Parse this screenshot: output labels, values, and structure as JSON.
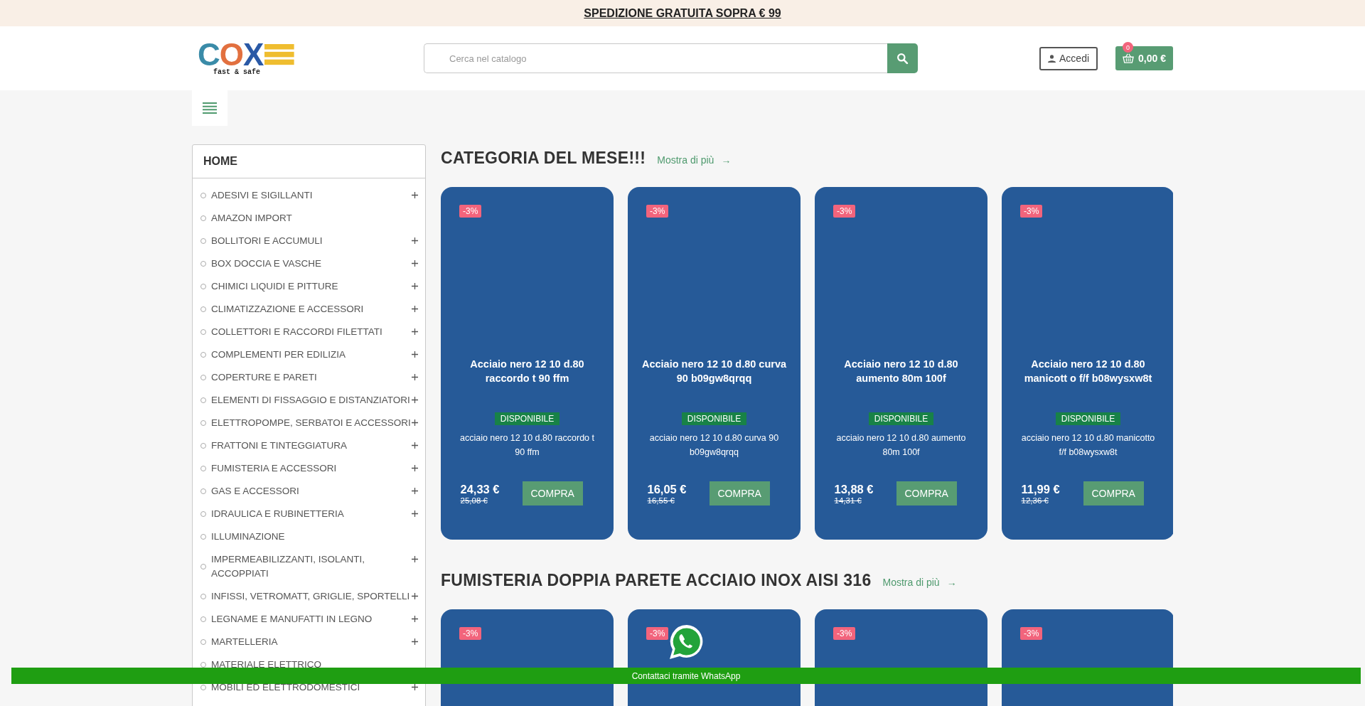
{
  "top_banner": {
    "text": "SPEDIZIONE GRATUITA SOPRA € 99"
  },
  "header": {
    "logo": {
      "text": "COX",
      "tagline": "fast & safe"
    },
    "search": {
      "placeholder": "Cerca nel catalogo"
    },
    "login": {
      "label": "Accedi"
    },
    "cart": {
      "count": "0",
      "total": "0,00 €"
    }
  },
  "sidebar": {
    "title": "HOME",
    "items": [
      {
        "label": "ADESIVI E SIGILLANTI",
        "expandable": true
      },
      {
        "label": "AMAZON IMPORT",
        "expandable": false
      },
      {
        "label": "BOLLITORI E ACCUMULI",
        "expandable": true
      },
      {
        "label": "BOX DOCCIA E VASCHE",
        "expandable": true
      },
      {
        "label": "CHIMICI LIQUIDI E PITTURE",
        "expandable": true
      },
      {
        "label": "CLIMATIZZAZIONE E ACCESSORI",
        "expandable": true
      },
      {
        "label": "COLLETTORI E RACCORDI FILETTATI",
        "expandable": true
      },
      {
        "label": "COMPLEMENTI PER EDILIZIA",
        "expandable": true
      },
      {
        "label": "COPERTURE E PARETI",
        "expandable": true
      },
      {
        "label": "ELEMENTI DI FISSAGGIO E DISTANZIATORI",
        "expandable": true
      },
      {
        "label": "ELETTROPOMPE, SERBATOI E ACCESSORI",
        "expandable": true
      },
      {
        "label": "FRATTONI E TINTEGGIATURA",
        "expandable": true
      },
      {
        "label": "FUMISTERIA E ACCESSORI",
        "expandable": true
      },
      {
        "label": "GAS E ACCESSORI",
        "expandable": true
      },
      {
        "label": "IDRAULICA E RUBINETTERIA",
        "expandable": true
      },
      {
        "label": "ILLUMINAZIONE",
        "expandable": false
      },
      {
        "label": "IMPERMEABILIZZANTI, ISOLANTI, ACCOPPIATI",
        "expandable": true
      },
      {
        "label": "INFISSI, VETROMATT, GRIGLIE, SPORTELLI",
        "expandable": true
      },
      {
        "label": "LEGNAME E MANUFATTI IN LEGNO",
        "expandable": true
      },
      {
        "label": "MARTELLERIA",
        "expandable": true
      },
      {
        "label": "MATERIALE ELETTRICO",
        "expandable": false
      },
      {
        "label": "MOBILI ED ELETTRODOMESTICI",
        "expandable": true
      }
    ]
  },
  "sections": [
    {
      "title": "CATEGORIA DEL MESE!!!",
      "more_link": "Mostra di più",
      "arrow": "→",
      "products": [
        {
          "discount": "-3%",
          "name": "Acciaio nero 12 10 d.80 raccordo t 90 ffm",
          "availability": "DISPONIBILE",
          "description": "acciaio nero 12 10 d.80 raccordo t 90 ffm",
          "price": "24,33 €",
          "old_price": "25,08 €",
          "button": "COMPRA"
        },
        {
          "discount": "-3%",
          "name": "Acciaio nero 12 10 d.80 curva 90 b09gw8qrqq",
          "availability": "DISPONIBILE",
          "description": "acciaio nero 12 10 d.80 curva 90 b09gw8qrqq",
          "price": "16,05 €",
          "old_price": "16,55 €",
          "button": "COMPRA"
        },
        {
          "discount": "-3%",
          "name": "Acciaio nero 12 10 d.80 aumento 80m 100f",
          "availability": "DISPONIBILE",
          "description": "acciaio nero 12 10 d.80 aumento 80m 100f",
          "price": "13,88 €",
          "old_price": "14,31 €",
          "button": "COMPRA"
        },
        {
          "discount": "-3%",
          "name": "Acciaio nero 12 10 d.80 manicott o f/f b08wysxw8t",
          "availability": "DISPONIBILE",
          "description": "acciaio nero 12 10 d.80 manicotto f/f b08wysxw8t",
          "price": "11,99 €",
          "old_price": "12,36 €",
          "button": "COMPRA"
        }
      ]
    },
    {
      "title": "FUMISTERIA DOPPIA PARETE ACCIAIO INOX AISI 316",
      "more_link": "Mostra di più",
      "arrow": "→",
      "products": [
        {
          "discount": "-3%"
        },
        {
          "discount": "-3%"
        },
        {
          "discount": "-3%"
        },
        {
          "discount": "-3%"
        }
      ]
    }
  ],
  "whatsapp_bar": {
    "text": "Contattaci tramite WhatsApp"
  }
}
